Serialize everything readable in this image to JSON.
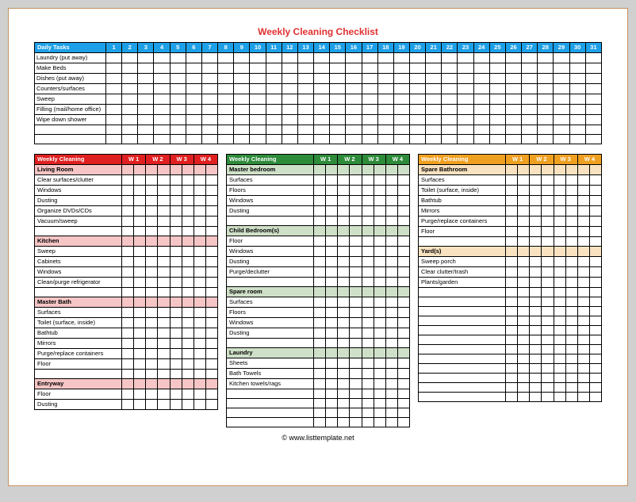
{
  "title": "Weekly Cleaning Checklist",
  "footer": "© www.listtemplate.net",
  "daily": {
    "header": "Daily Tasks",
    "days": [
      "1",
      "2",
      "3",
      "4",
      "5",
      "6",
      "7",
      "8",
      "9",
      "10",
      "11",
      "12",
      "13",
      "14",
      "15",
      "16",
      "17",
      "18",
      "19",
      "20",
      "21",
      "22",
      "23",
      "24",
      "25",
      "26",
      "27",
      "28",
      "29",
      "30",
      "31"
    ],
    "tasks": [
      "Laundry (put away)",
      "Make Beds",
      "Dishes (put away)",
      "Counters/surfaces",
      "Sweep",
      "Filling (mail/home office)",
      "Wipe down shower"
    ],
    "blank_rows": 2
  },
  "weekly_header": "Weekly Cleaning",
  "week_cols": [
    "W 1",
    "W 2",
    "W 3",
    "W 4"
  ],
  "columns": [
    {
      "color": "red",
      "groups": [
        {
          "name": "Living Room",
          "tasks": [
            "Clear surfaces/clutter",
            "Windows",
            "Dusting",
            "Organize DVDs/CDs",
            "Vacuum/sweep"
          ],
          "blank_after": 1
        },
        {
          "name": "Kitchen",
          "tasks": [
            "Sweep",
            "Cabinets",
            "Windows",
            "Clean/purge refrigerator"
          ],
          "blank_after": 1
        },
        {
          "name": "Master Bath",
          "tasks": [
            "Surfaces",
            "Toilet (surface, inside)",
            "Bathtub",
            "Mirrors",
            "Purge/replace containers",
            "Floor"
          ],
          "blank_after": 1
        },
        {
          "name": "Entryway",
          "tasks": [
            "Floor",
            "Dusting"
          ],
          "blank_after": 0
        }
      ]
    },
    {
      "color": "green",
      "groups": [
        {
          "name": "Master bedroom",
          "tasks": [
            "Surfaces",
            "Floors",
            "Windows",
            "Dusting"
          ],
          "blank_after": 1
        },
        {
          "name": "Child Bedroom(s)",
          "tasks": [
            "Floor",
            "Windows",
            "Dusting",
            "Purge/declutter"
          ],
          "blank_after": 1
        },
        {
          "name": "Spare room",
          "tasks": [
            "Surfaces",
            "Floors",
            "Windows",
            "Dusting"
          ],
          "blank_after": 1
        },
        {
          "name": "Laundry",
          "tasks": [
            "Sheets",
            "Bath Towels",
            "Kitchen towels/rags"
          ],
          "blank_after": 4
        }
      ]
    },
    {
      "color": "orange",
      "groups": [
        {
          "name": "Spare Bathroom",
          "tasks": [
            "Surfaces",
            "Toilet (surface, inside)",
            "Bathtub",
            "Mirrors",
            "Purge/replace containers",
            "Floor"
          ],
          "blank_after": 1
        },
        {
          "name": "Yard(s)",
          "tasks": [
            "Sweep porch",
            "Clear clutter/trash",
            "Plants/garden"
          ],
          "blank_after": 12
        }
      ]
    }
  ]
}
